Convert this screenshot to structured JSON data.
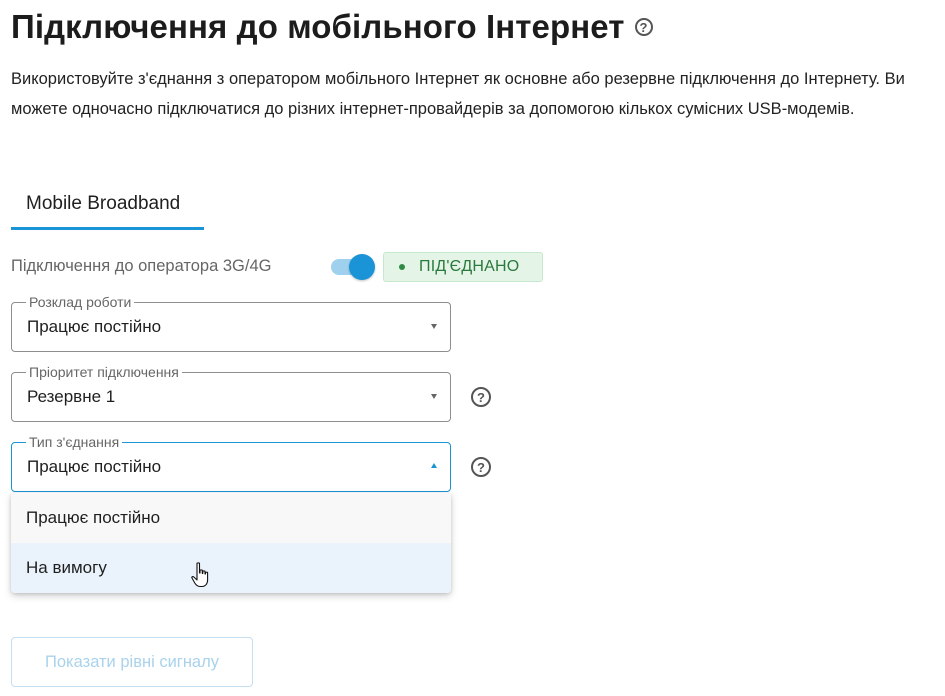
{
  "header": {
    "title": "Підключення до мобільного Інтернет",
    "help_icon": "question-circle-icon",
    "description": "Використовуйте з'єднання з оператором мобільного Інтернет як основне або резервне підключення до Інтернету. Ви можете одночасно підключатися до різних інтернет-провайдерів за допомогою кількох сумісних USB-модемів."
  },
  "tabs": [
    {
      "label": "Mobile Broadband",
      "active": true
    }
  ],
  "connection": {
    "label": "Підключення до оператора 3G/4G",
    "toggle_on": true,
    "status": "ПІД'ЄДНАНО",
    "status_color": "#2b7a3d"
  },
  "fields": {
    "schedule": {
      "legend": "Розклад роботи",
      "value": "Працює постійно"
    },
    "priority": {
      "legend": "Пріоритет підключення",
      "value": "Резервне 1"
    },
    "connection_type": {
      "legend": "Тип з'єднання",
      "value": "Працює постійно",
      "options": [
        "Працює постійно",
        "На вимогу"
      ],
      "hovered_option": "На вимогу"
    }
  },
  "buttons": {
    "show_signal": "Показати рівні сигналу"
  },
  "colors": {
    "accent": "#1a94d6",
    "success_bg": "#e4f5e8"
  }
}
